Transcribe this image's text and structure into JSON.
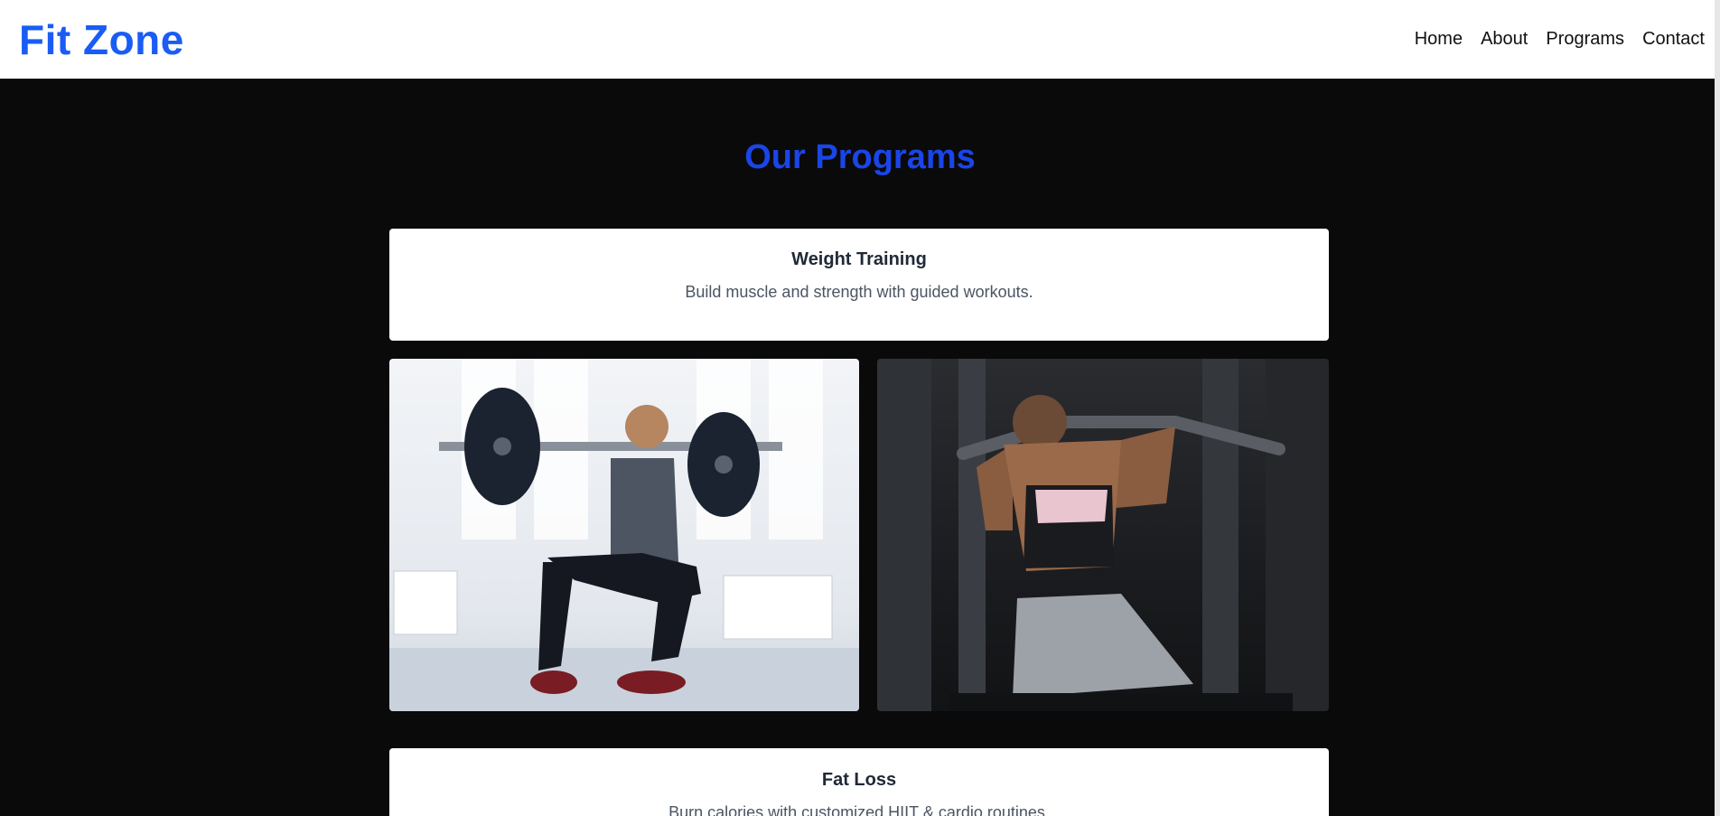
{
  "header": {
    "logo": "Fit Zone",
    "nav": [
      "Home",
      "About",
      "Programs",
      "Contact"
    ]
  },
  "programs": {
    "title": "Our Programs",
    "items": [
      {
        "title": "Weight Training",
        "description": "Build muscle and strength with guided workouts."
      },
      {
        "title": "Fat Loss",
        "description": "Burn calories with customized HIIT & cardio routines."
      }
    ]
  },
  "colors": {
    "brand": "#1a5cf5",
    "heading": "#1a45e8",
    "background": "#0a0a0a"
  }
}
